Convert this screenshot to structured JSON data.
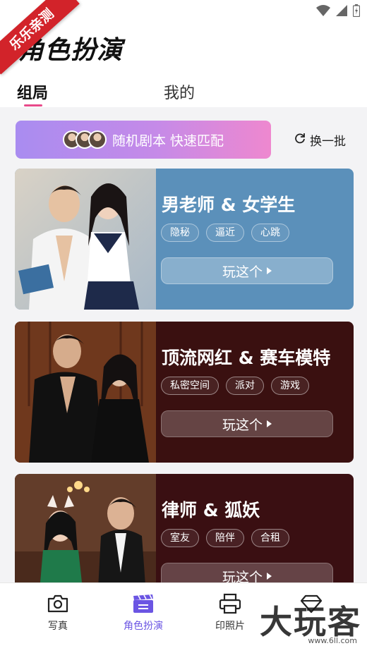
{
  "overlay_badge": "乐乐亲测",
  "app_title": "角色扮演",
  "tabs": [
    {
      "label": "组局",
      "active": true
    },
    {
      "label": "我的",
      "active": false
    }
  ],
  "match": {
    "label": "随机剧本 快速匹配"
  },
  "refresh": {
    "label": "换一批"
  },
  "cards": [
    {
      "title": "男老师 & 女学生",
      "tags": [
        "隐秘",
        "逼近",
        "心跳"
      ],
      "play_label": "玩这个",
      "bg": "#5b90ba"
    },
    {
      "title": "顶流网红 & 赛车模特",
      "tags": [
        "私密空间",
        "派对",
        "游戏"
      ],
      "play_label": "玩这个",
      "bg": "#3a1010"
    },
    {
      "title": "律师 & 狐妖",
      "tags": [
        "室友",
        "陪伴",
        "合租"
      ],
      "play_label": "玩这个",
      "bg": "#3a0f12"
    }
  ],
  "bottom_nav": [
    {
      "label": "写真",
      "icon": "camera-icon",
      "active": false
    },
    {
      "label": "角色扮演",
      "icon": "clapperboard-icon",
      "active": true
    },
    {
      "label": "印照片",
      "icon": "printer-icon",
      "active": false
    },
    {
      "label": "",
      "icon": "diamond-icon",
      "active": false
    }
  ],
  "watermark": {
    "text": "大玩客",
    "sub": "www.6ll.com"
  },
  "colors": {
    "accent": "#6b55e3",
    "tab_underline": "#e84a8a",
    "ribbon": "#d2232a"
  }
}
